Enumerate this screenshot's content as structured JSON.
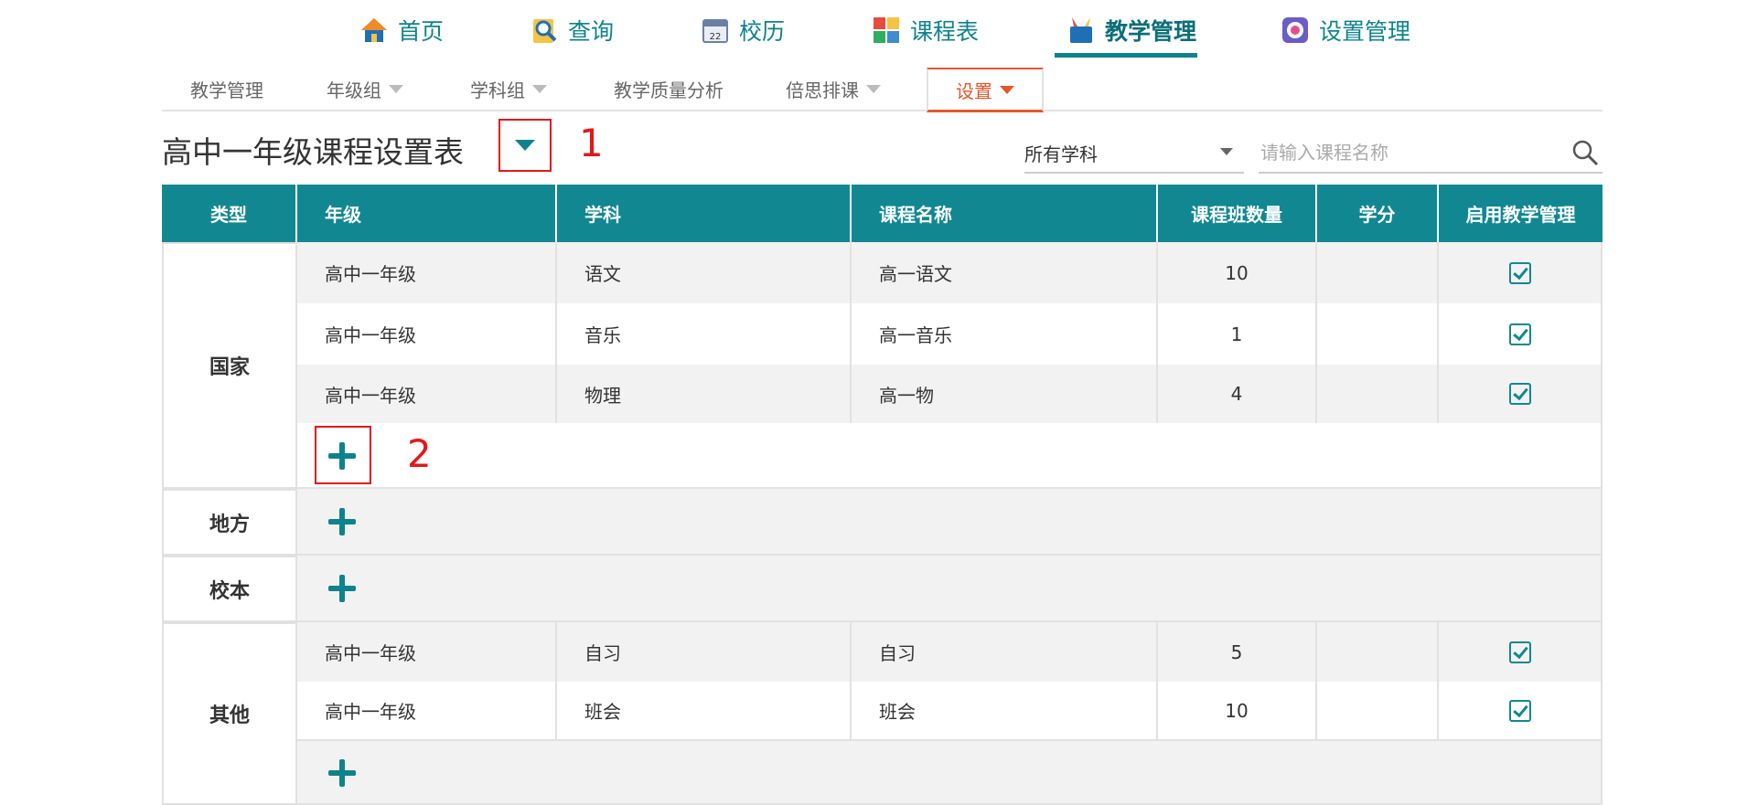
{
  "nav": {
    "items": [
      {
        "label": "首页",
        "icon": "home-icon"
      },
      {
        "label": "查询",
        "icon": "search-doc-icon"
      },
      {
        "label": "校历",
        "icon": "calendar-icon"
      },
      {
        "label": "课程表",
        "icon": "schedule-icon"
      },
      {
        "label": "教学管理",
        "icon": "teaching-icon",
        "active": true
      },
      {
        "label": "设置管理",
        "icon": "settings-icon"
      }
    ],
    "accent": "#0e838d"
  },
  "subnav": {
    "items": [
      {
        "label": "教学管理"
      },
      {
        "label": "年级组"
      },
      {
        "label": "学科组"
      },
      {
        "label": "教学质量分析"
      },
      {
        "label": "倍思排课"
      },
      {
        "label": "设置",
        "active": true
      }
    ],
    "active_color": "#e5562a"
  },
  "page": {
    "title": "高中一年级课程设置表",
    "annotation_1": "1",
    "annotation_2": "2",
    "subject_filter": "所有学科",
    "search_placeholder": "请输入课程名称"
  },
  "table": {
    "headers": [
      "类型",
      "年级",
      "学科",
      "课程名称",
      "课程班数量",
      "学分",
      "启用教学管理"
    ],
    "groups": [
      {
        "type": "国家",
        "rows": [
          {
            "grade": "高中一年级",
            "subject": "语文",
            "course": "高一语文",
            "classes": "10",
            "credit": "",
            "enabled": true
          },
          {
            "grade": "高中一年级",
            "subject": "音乐",
            "course": "高一音乐",
            "classes": "1",
            "credit": "",
            "enabled": true
          },
          {
            "grade": "高中一年级",
            "subject": "物理",
            "course": "高一物",
            "classes": "4",
            "credit": "",
            "enabled": true
          }
        ]
      },
      {
        "type": "地方",
        "rows": []
      },
      {
        "type": "校本",
        "rows": []
      },
      {
        "type": "其他",
        "rows": [
          {
            "grade": "高中一年级",
            "subject": "自习",
            "course": "自习",
            "classes": "5",
            "credit": "",
            "enabled": true
          },
          {
            "grade": "高中一年级",
            "subject": "班会",
            "course": "班会",
            "classes": "10",
            "credit": "",
            "enabled": true
          }
        ]
      }
    ]
  }
}
